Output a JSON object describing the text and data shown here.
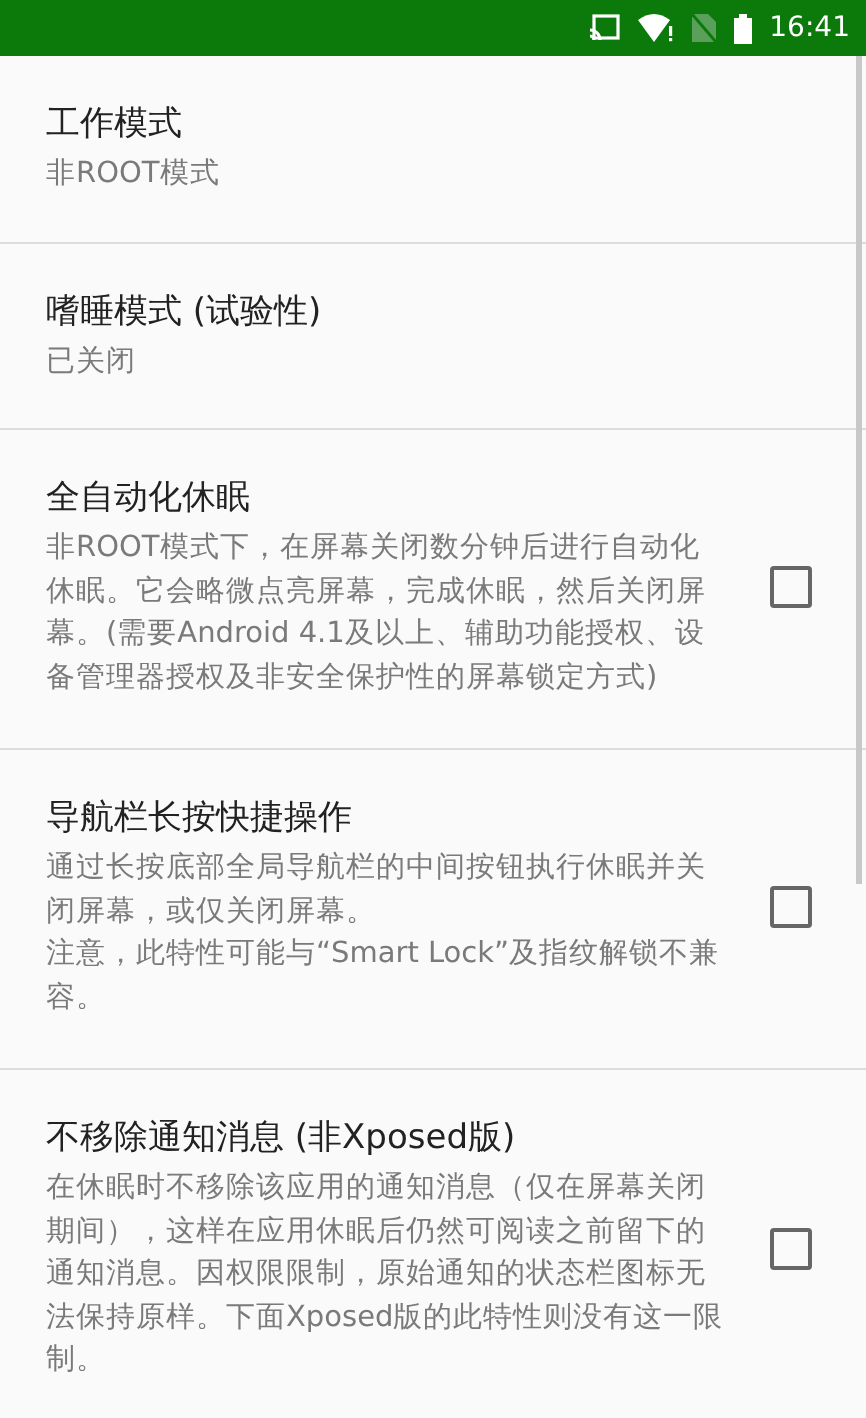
{
  "status_bar": {
    "time": "16:41"
  },
  "settings": [
    {
      "kind": "summary",
      "title": "工作模式",
      "summary": "非ROOT模式"
    },
    {
      "kind": "summary",
      "title": "嗜睡模式 (试验性)",
      "summary": "已关闭"
    },
    {
      "kind": "checkbox",
      "title": "全自动化休眠",
      "paragraphs": [
        "非ROOT模式下，在屏幕关闭数分钟后进行自动化休眠。它会略微点亮屏幕，完成休眠，然后关闭屏幕。(需要Android 4.1及以上、辅助功能授权、设备管理器授权及非安全保护性的屏幕锁定方式)"
      ],
      "checked": false
    },
    {
      "kind": "checkbox",
      "title": "导航栏长按快捷操作",
      "paragraphs": [
        "通过长按底部全局导航栏的中间按钮执行休眠并关闭屏幕，或仅关闭屏幕。",
        "注意，此特性可能与“Smart Lock”及指纹解锁不兼容。"
      ],
      "checked": false
    },
    {
      "kind": "checkbox",
      "title": "不移除通知消息 (非Xposed版)",
      "paragraphs": [
        "在休眠时不移除该应用的通知消息（仅在屏幕关闭期间），这样在应用休眠后仍然可阅读之前留下的通知消息。因权限限制，原始通知的状态栏图标无法保持原样。下面Xposed版的此特性则没有这一限制。"
      ],
      "checked": false
    }
  ]
}
